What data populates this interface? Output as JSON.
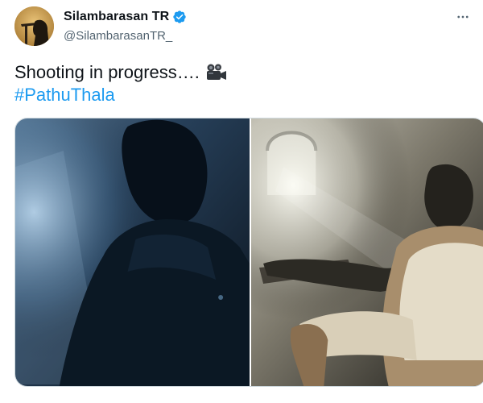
{
  "author": {
    "display_name": "Silambarasan TR",
    "handle": "@SilambarasanTR_",
    "verified": true
  },
  "icons": {
    "verified": "verified-badge-icon",
    "more": "more-options-icon",
    "camera": "movie-camera-icon"
  },
  "tweet": {
    "text": "Shooting in progress….",
    "hashtag": "#PathuThala"
  },
  "media": [
    {
      "description_icon": "photo-silhouette"
    },
    {
      "description_icon": "photo-armchair"
    }
  ],
  "colors": {
    "link": "#1d9bf0",
    "secondary_text": "#536471",
    "verified": "#1d9bf0"
  }
}
